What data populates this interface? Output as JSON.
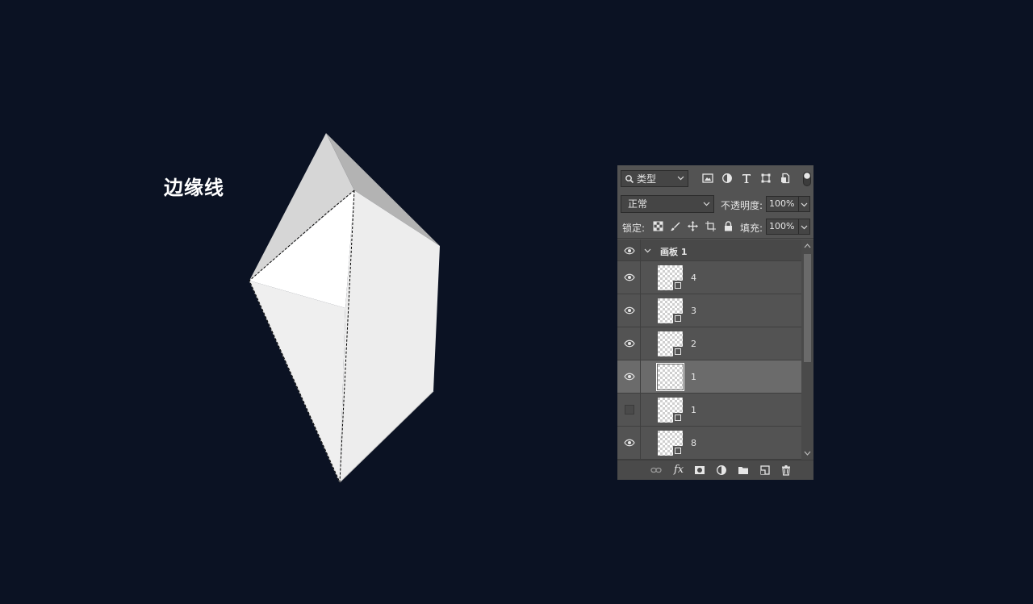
{
  "canvas": {
    "caption": "边缘线",
    "background": "#0b1223"
  },
  "layers_panel": {
    "filter": {
      "kind_label": "类型"
    },
    "filter_icons": [
      "image-filter-icon",
      "adjustment-filter-icon",
      "type-filter-icon",
      "shape-filter-icon",
      "smart-object-filter-icon",
      "filter-toggle-icon"
    ],
    "blend_mode": "正常",
    "opacity_label": "不透明度:",
    "opacity_value": "100%",
    "lock_label": "锁定:",
    "lock_icons": [
      "lock-transparent-icon",
      "lock-image-icon",
      "lock-position-icon",
      "lock-artboard-icon",
      "lock-all-icon"
    ],
    "fill_label": "填充:",
    "fill_value": "100%",
    "group": {
      "name": "画板 1",
      "visible": true,
      "expanded": true
    },
    "layers": [
      {
        "name": "4",
        "visible": true,
        "selected": false
      },
      {
        "name": "3",
        "visible": true,
        "selected": false
      },
      {
        "name": "2",
        "visible": true,
        "selected": false
      },
      {
        "name": "1",
        "visible": true,
        "selected": true
      },
      {
        "name": "1",
        "visible": false,
        "selected": false
      },
      {
        "name": "8",
        "visible": true,
        "selected": false
      }
    ],
    "bottom_icons": [
      "link-layers-icon",
      "fx-icon",
      "add-mask-icon",
      "adjustment-layer-icon",
      "new-group-icon",
      "new-layer-icon",
      "delete-layer-icon"
    ],
    "fx_label": "fx"
  }
}
